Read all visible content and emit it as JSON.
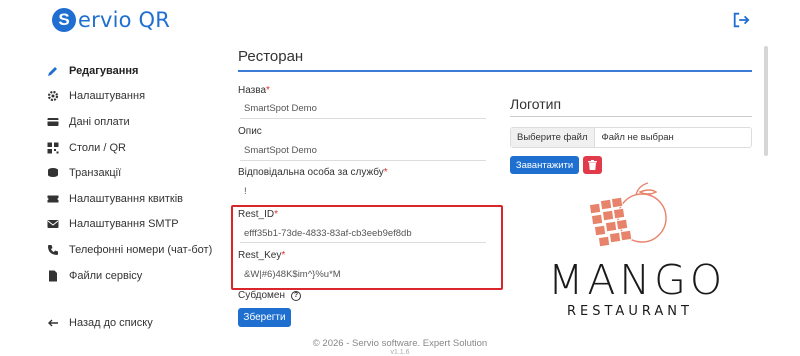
{
  "brand": {
    "letter": "S",
    "name": "ervio QR"
  },
  "sidebar": {
    "items": [
      {
        "label": "Редагування",
        "icon": "pencil-icon",
        "active": true
      },
      {
        "label": "Налаштування",
        "icon": "gear-icon"
      },
      {
        "label": "Дані оплати",
        "icon": "credit-card-icon"
      },
      {
        "label": "Столи / QR",
        "icon": "qr-code-icon"
      },
      {
        "label": "Транзакції",
        "icon": "coins-icon"
      },
      {
        "label": "Налаштування квитків",
        "icon": "ticket-icon"
      },
      {
        "label": "Налаштування SMTP",
        "icon": "envelope-icon"
      },
      {
        "label": "Телефонні номери (чат-бот)",
        "icon": "phone-icon"
      },
      {
        "label": "Файли сервісу",
        "icon": "file-icon"
      }
    ],
    "back": {
      "label": "Назад до списку",
      "icon": "arrow-left-icon"
    }
  },
  "main": {
    "title": "Ресторан",
    "fields": {
      "name": {
        "label": "Назва",
        "required": "*",
        "value": "SmartSpot Demo"
      },
      "description": {
        "label": "Опис",
        "value": "SmartSpot Demo"
      },
      "responsible": {
        "label": "Відповідальна особа за службу",
        "required": "*",
        "value": "!"
      },
      "rest_id": {
        "label": "Rest_ID",
        "required": "*",
        "value": "efff35b1-73de-4833-83af-cb3eeb9ef8db"
      },
      "rest_key": {
        "label": "Rest_Key",
        "required": "*",
        "value": "&W|#6)48K$im^}%u*M"
      }
    },
    "subdomen": {
      "label": "Субдомен",
      "help": "?"
    },
    "save_label": "Зберегти"
  },
  "logo_panel": {
    "title": "Логотип",
    "choose_file_label": "Выберите файл",
    "no_file_label": "Файл не выбран",
    "upload_label": "Завантажити",
    "delete_icon": "trash-icon",
    "logo_word": "MANGO",
    "logo_sub": "RESTAURANT"
  },
  "footer": {
    "text": "© 2026 - Servio software. Expert Solution",
    "version": "v1.1.6"
  },
  "colors": {
    "primary": "#1f6fd1",
    "danger": "#e03a4b",
    "highlight": "#d9262a",
    "mango": "#e8836b"
  }
}
